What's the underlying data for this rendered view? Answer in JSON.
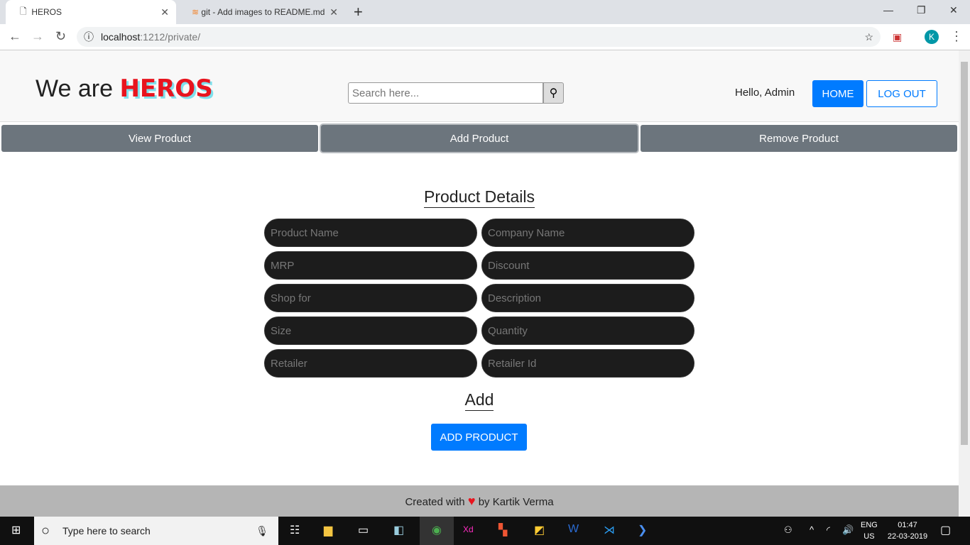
{
  "browser": {
    "tabs": [
      {
        "title": "HEROS"
      },
      {
        "title": "git - Add images to README.md"
      }
    ],
    "url_host": "localhost",
    "url_rest": ":1212/private/",
    "profile": "K"
  },
  "header": {
    "brand_prefix": "We are",
    "brand_name": "HEROS",
    "search_placeholder": "Search here...",
    "greeting": "Hello, Admin",
    "home_label": "HOME",
    "logout_label": "LOG OUT"
  },
  "menu": [
    {
      "label": "View Product"
    },
    {
      "label": "Add Product"
    },
    {
      "label": "Remove Product"
    }
  ],
  "form": {
    "title": "Product Details",
    "fields": [
      "Product Name",
      "Company Name",
      "MRP",
      "Discount",
      "Shop for",
      "Description",
      "Size",
      "Quantity",
      "Retailer",
      "Retailer Id"
    ],
    "section": "Add",
    "submit_label": "ADD PRODUCT"
  },
  "footer": {
    "prefix": "Created with",
    "suffix": "by Kartik Verma"
  },
  "taskbar": {
    "search_placeholder": "Type here to search",
    "lang1": "ENG",
    "lang2": "US",
    "time": "01:47",
    "date": "22-03-2019"
  }
}
